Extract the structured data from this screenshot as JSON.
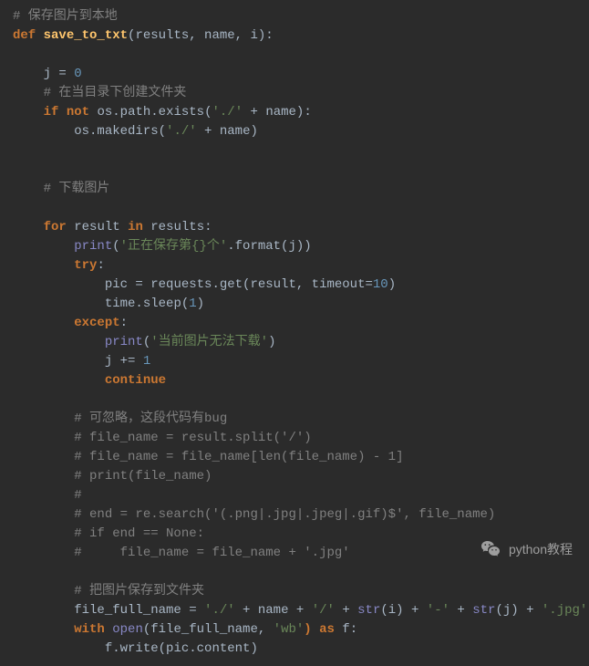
{
  "code": {
    "c1": "# 保存图片到本地",
    "def": "def",
    "fn": "save_to_txt",
    "params": "(results, name, i):",
    "j": "j",
    "eq": " = ",
    "zero": "0",
    "c2": "# 在当目录下创建文件夹",
    "if": "if",
    "not": "not",
    "os": "os",
    "path": ".path.exists(",
    "s_dot1": "'./'",
    "plus": " + ",
    "name": "name",
    "rp": "):",
    "makedirs": "os.makedirs(",
    "s_dot2": "'./'",
    "rp2": ")",
    "c3": "# 下载图片",
    "for": "for",
    "result": "result",
    "in": "in",
    "results": "results:",
    "print": "print",
    "lp": "(",
    "s_save": "'正在保存第{}个'",
    "fmt": ".format(j))",
    "try": "try",
    "colon": ":",
    "pic": "pic = requests.get(result, timeout=",
    "ten": "10",
    "rp3": ")",
    "sleep": "time.sleep(",
    "one": "1",
    "rp4": ")",
    "except": "except",
    "s_fail": "'当前图片无法下载'",
    "rp5": ")",
    "jinc": "j += ",
    "one2": "1",
    "continue": "continue",
    "c4": "# 可忽略，这段代码有bug",
    "c5": "# file_name = result.split('/')",
    "c6": "# file_name = file_name[len(file_name) - 1]",
    "c7": "# print(file_name)",
    "c8": "#",
    "c9": "# end = re.search('(.png|.jpg|.jpeg|.gif)$', file_name)",
    "c10": "# if end == None:",
    "c11": "#     file_name = file_name + '.jpg'",
    "c12": "# 把图片保存到文件夹",
    "ffn": "file_full_name = ",
    "s_p1": "'./'",
    "s_p2": "'/'",
    "stri": "str",
    "i": "(i)",
    "s_dash": "'-'",
    "jparen": "(j)",
    "s_jpg": "'.jpg'",
    "with": "with",
    "open": "open",
    "wargs": "(file_full_name, ",
    "s_wb": "'wb'",
    "as": ") as",
    "f": " f:",
    "fwrite": "f.write(pic.content)"
  },
  "watermark": {
    "text": "python教程"
  }
}
